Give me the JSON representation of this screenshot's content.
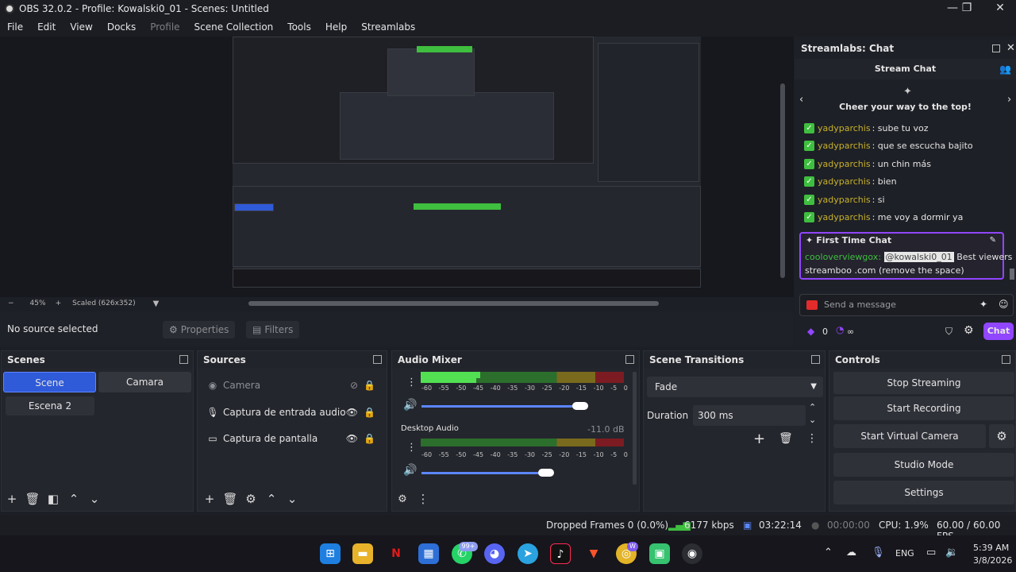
{
  "window": {
    "title": "OBS 32.0.2 - Profile: Kowalski0_01 - Scenes: Untitled",
    "minimize": "—",
    "maximize": "❐",
    "close": "✕"
  },
  "menu": [
    "File",
    "Edit",
    "View",
    "Docks",
    "Profile",
    "Scene Collection",
    "Tools",
    "Help",
    "Streamlabs"
  ],
  "zoom": {
    "minus": "−",
    "value": "45%",
    "plus": "+",
    "scaled": "Scaled (626x352)"
  },
  "source_bar": {
    "no_source": "No source selected",
    "properties": "Properties",
    "filters": "Filters"
  },
  "chat": {
    "dock_title": "Streamlabs: Chat",
    "header": "Stream Chat",
    "cheer": "Cheer your way to the top!",
    "messages": [
      {
        "user": "yadyparchis",
        "text": ": sube tu voz"
      },
      {
        "user": "yadyparchis",
        "text": ": que se escucha bajito"
      },
      {
        "user": "yadyparchis",
        "text": ": un chin más"
      },
      {
        "user": "yadyparchis",
        "text": ": bien"
      },
      {
        "user": "yadyparchis",
        "text": ": si"
      },
      {
        "user": "yadyparchis",
        "text": ": me voy a dormir ya"
      }
    ],
    "first_time": {
      "title": "First Time Chat",
      "user": "cooloverviewgox",
      "mention": "@kowalski0_01",
      "text1": "Best viewers",
      "text2": "streamboo .com (remove the space)"
    },
    "input_placeholder": "Send a message",
    "points": "0",
    "infinity": "∞",
    "chat_button": "Chat"
  },
  "scenes": {
    "title": "Scenes",
    "items": [
      "Scene",
      "Camara",
      "Escena 2"
    ]
  },
  "sources": {
    "title": "Sources",
    "items": [
      "Camera",
      "Captura de entrada audio",
      "Captura de pantalla"
    ]
  },
  "mixer": {
    "title": "Audio Mixer",
    "ticks": [
      "-60",
      "-55",
      "-50",
      "-45",
      "-40",
      "-35",
      "-30",
      "-25",
      "-20",
      "-15",
      "-10",
      "-5",
      "0"
    ],
    "desktop_label": "Desktop Audio",
    "desktop_db": "-11.0 dB"
  },
  "transitions": {
    "title": "Scene Transitions",
    "type": "Fade",
    "duration_label": "Duration",
    "duration_value": "300 ms"
  },
  "controls": {
    "title": "Controls",
    "buttons": [
      "Stop Streaming",
      "Start Recording",
      "Start Virtual Camera",
      "Studio Mode",
      "Settings"
    ]
  },
  "status": {
    "dropped": "Dropped Frames 0 (0.0%)",
    "kbps": "6177 kbps",
    "live_time": "03:22:14",
    "rec_time": "00:00:00",
    "cpu": "CPU: 1.9%",
    "fps": "60.00 / 60.00 FPS"
  },
  "taskbar": {
    "lang": "ENG",
    "time": "5:39 AM",
    "date": "3/8/2026",
    "whatsapp_badge": "99+",
    "telegram_badge": "W"
  },
  "colors": {
    "accent_blue": "#2f5ad8",
    "chat_purple": "#9146ff",
    "check_green": "#3fbf3f",
    "username_gold": "#c7b12a"
  }
}
